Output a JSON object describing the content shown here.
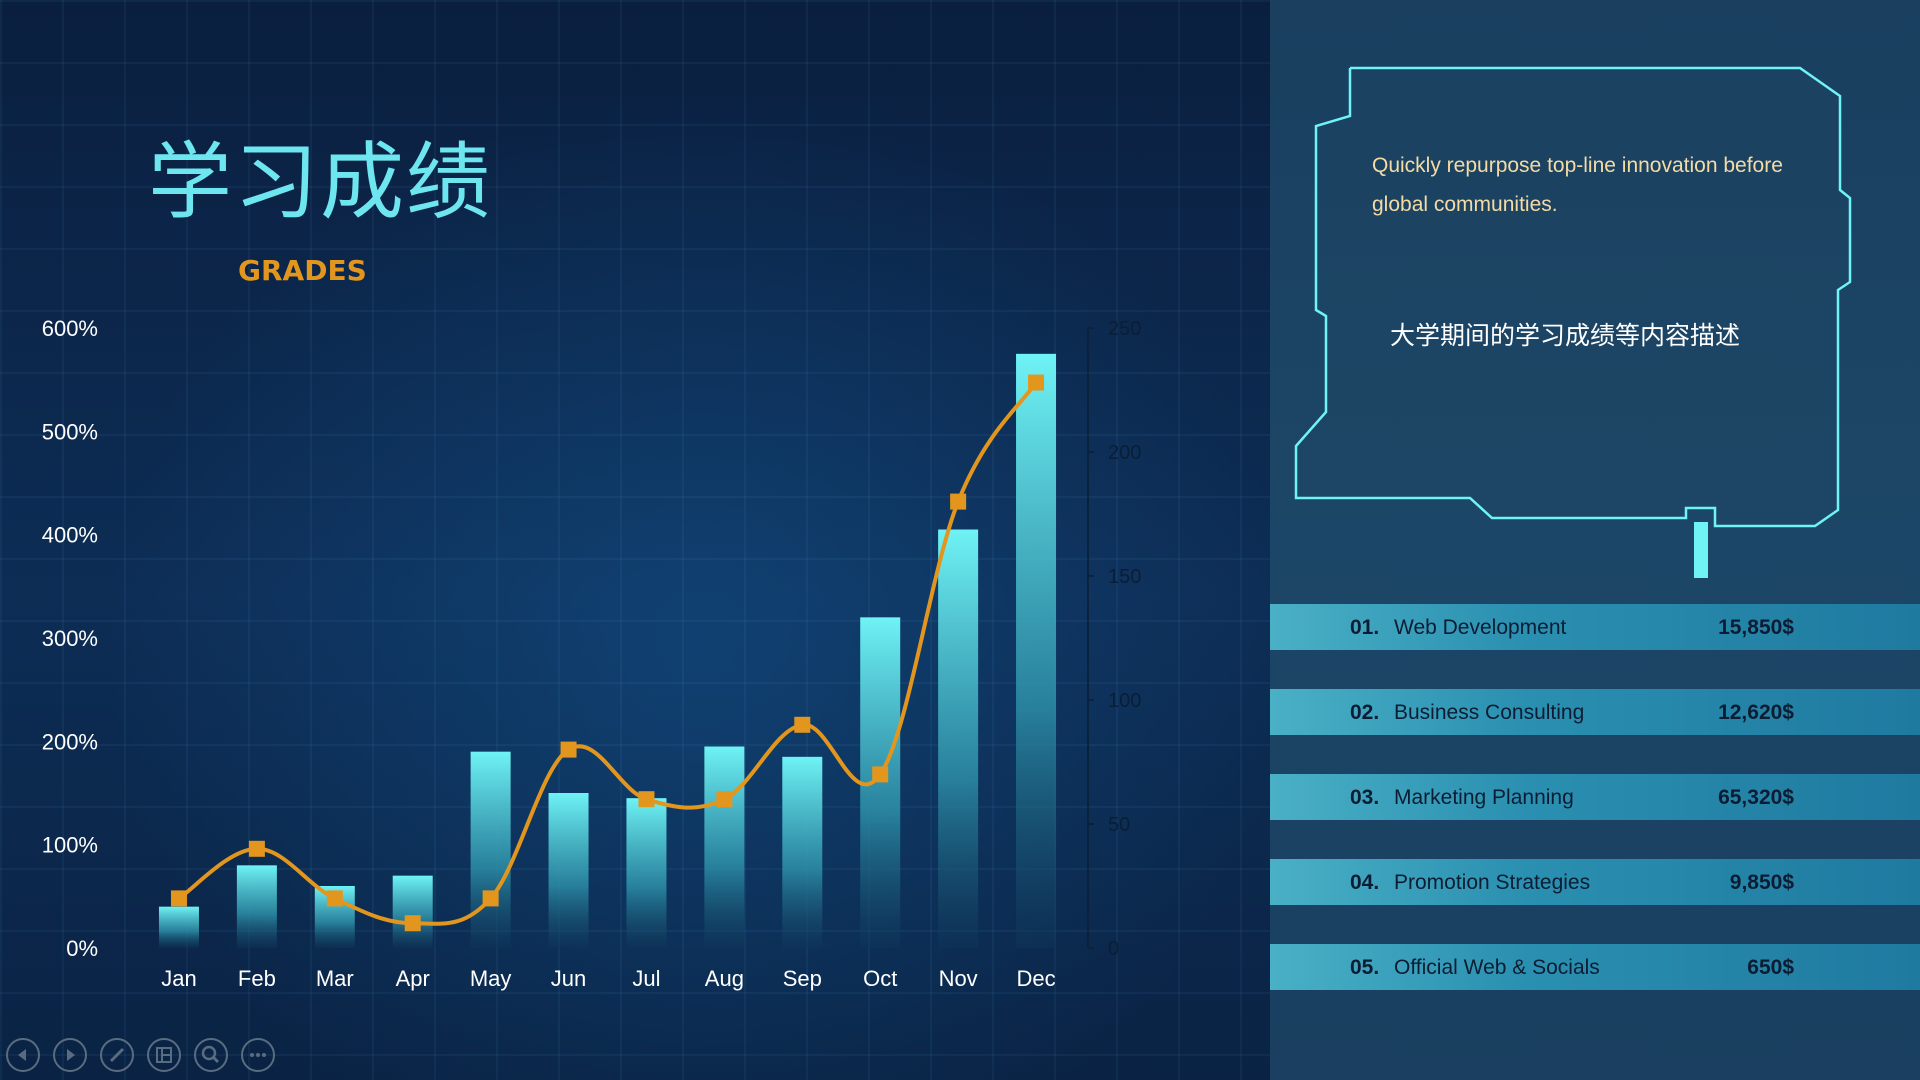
{
  "title_cn": "学习成绩",
  "title_en": "GRADES",
  "description": {
    "text_en": "Quickly repurpose top-line innovation before global communities.",
    "text_cn": "大学期间的学习成绩等内容描述"
  },
  "list": [
    {
      "num": "01.",
      "label": "Web Development",
      "amount": "15,850$"
    },
    {
      "num": "02.",
      "label": "Business Consulting",
      "amount": "12,620$"
    },
    {
      "num": "03.",
      "label": "Marketing Planning",
      "amount": "65,320$"
    },
    {
      "num": "04.",
      "label": "Promotion Strategies",
      "amount": "9,850$"
    },
    {
      "num": "05.",
      "label": "Official Web & Socials",
      "amount": "650$"
    }
  ],
  "controls": [
    "prev-icon",
    "next-icon",
    "pen-icon",
    "slides-grid-icon",
    "zoom-icon",
    "more-icon"
  ],
  "colors": {
    "bar_top": "#6ff3f5",
    "line": "#e3961e",
    "accent": "#6ee6ef"
  },
  "chart_data": {
    "type": "bar",
    "categories": [
      "Jan",
      "Feb",
      "Mar",
      "Apr",
      "May",
      "Jun",
      "Jul",
      "Aug",
      "Sep",
      "Oct",
      "Nov",
      "Dec"
    ],
    "series": [
      {
        "type": "bar",
        "axis": "left",
        "values": [
          40,
          80,
          60,
          70,
          190,
          150,
          145,
          195,
          185,
          320,
          405,
          575
        ]
      },
      {
        "type": "line",
        "axis": "right",
        "values": [
          20,
          40,
          20,
          10,
          20,
          80,
          60,
          60,
          90,
          70,
          180,
          228
        ]
      }
    ],
    "ylim": [
      0,
      600
    ],
    "yticks": [
      "0%",
      "100%",
      "200%",
      "300%",
      "400%",
      "500%",
      "600%"
    ],
    "y2lim": [
      0,
      250
    ],
    "y2ticks": [
      "0",
      "50",
      "100",
      "150",
      "200",
      "250"
    ]
  }
}
